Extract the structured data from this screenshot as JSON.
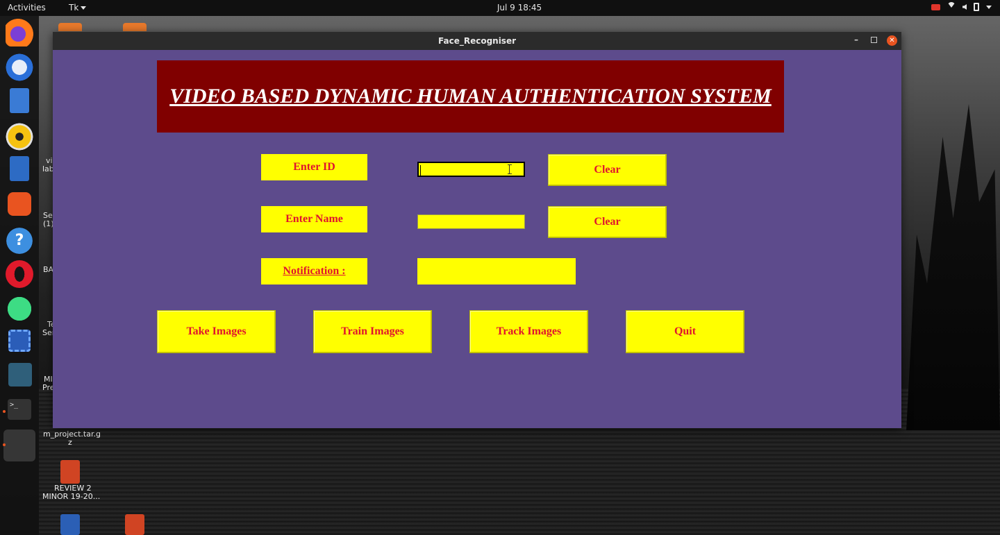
{
  "topbar": {
    "activities": "Activities",
    "app_menu": "Tk",
    "clock": "Jul 9  18:45"
  },
  "desktop": {
    "labels": [
      {
        "text": "vi"
      },
      {
        "text": "lab"
      },
      {
        "text": "Se"
      },
      {
        "text": "(1)"
      },
      {
        "text": "BA"
      },
      {
        "text": "Te"
      },
      {
        "text": "Ser"
      },
      {
        "text": "MI"
      },
      {
        "text": "Pre"
      }
    ],
    "archive_label_1": "m_project.tar.g",
    "archive_label_2": "z",
    "ppt_label_1": "REVIEW 2",
    "ppt_label_2": "MINOR 19-20..."
  },
  "window": {
    "title": "Face_Recogniser",
    "min_glyph": "–",
    "close_glyph": "✕"
  },
  "app": {
    "banner_title": "VIDEO BASED DYNAMIC HUMAN AUTHENTICATION SYSTEM",
    "id_label": "Enter ID",
    "id_value": "",
    "id_clear": "Clear",
    "name_label": "Enter Name",
    "name_value": "",
    "name_clear": "Clear",
    "notification_label": "Notification : ",
    "notification_value": "",
    "take_images": "Take Images",
    "train_images": "Train Images",
    "track_images": "Track Images",
    "quit": "Quit"
  },
  "colors": {
    "window_bg": "#5d4b8c",
    "banner_bg": "#800000",
    "widget_bg": "#ffff00",
    "widget_fg": "#e0142e",
    "accent": "#e95420"
  },
  "icons": {
    "dock": [
      "firefox-icon",
      "thunderbird-icon",
      "files-icon",
      "rhythmbox-icon",
      "libreoffice-writer-icon",
      "software-center-icon",
      "help-icon",
      "opera-icon",
      "android-studio-icon",
      "screenshot-icon",
      "mysql-workbench-icon",
      "terminal-icon",
      "tk-app-icon"
    ],
    "tray": [
      "camera-icon",
      "wifi-icon",
      "volume-icon",
      "battery-icon"
    ]
  }
}
